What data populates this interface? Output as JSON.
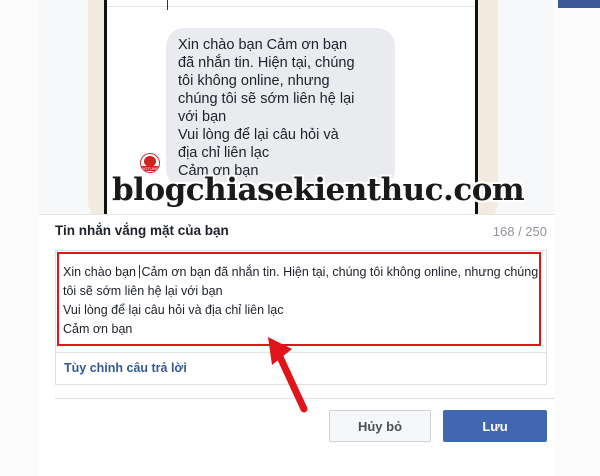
{
  "preview": {
    "bubble_lines": [
      "Xin chào bạn Cảm ơn bạn",
      "đã nhắn tin. Hiện tại, chúng",
      "tôi không online, nhưng",
      "chúng tôi sẽ sớm liên hệ lại",
      "với bạn",
      "Vui lòng để lại câu hỏi và",
      "địa chỉ liên lạc",
      "Cảm ơn bạn"
    ],
    "avatar_label": "HOTLINE"
  },
  "watermark": "blogchiasekienthuc.com",
  "form": {
    "title": "Tin nhắn vắng mặt của bạn",
    "counter": "168 / 250",
    "message": {
      "line1_before_caret": "Xin chào bạn ",
      "line1_after_caret": "Cảm ơn bạn đã nhắn tin. Hiện tại, chúng tôi không online, nhưng chúng",
      "line2": "tôi sẽ sớm liên hệ lại với bạn",
      "line3": "Vui lòng để lại câu hỏi và địa chỉ liên lạc",
      "line4": "Cảm ơn bạn"
    },
    "customize_link": "Tùy chỉnh câu trả lời"
  },
  "buttons": {
    "cancel": "Hủy bỏ",
    "save": "Lưu"
  },
  "colors": {
    "highlight": "#e0141b",
    "save_button": "#4267b2",
    "link": "#365899"
  }
}
